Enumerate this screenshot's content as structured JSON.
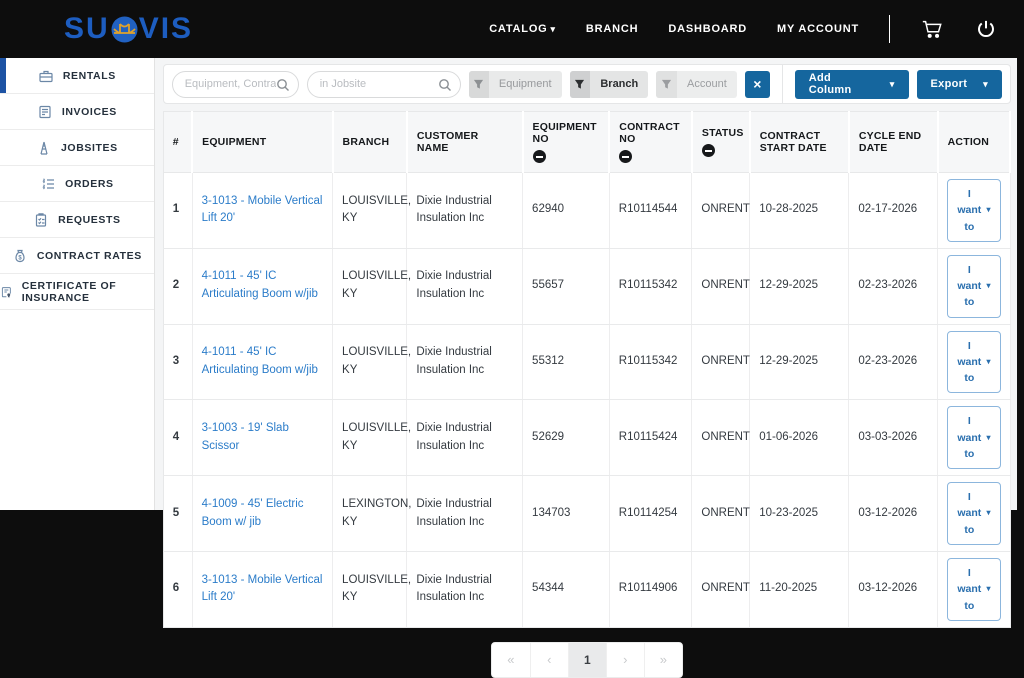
{
  "colors": {
    "brand_blue": "#1d5dc0",
    "button_blue": "#15669e",
    "link_blue": "#2b7cc9",
    "active_sidebar_bar": "#1d53a4",
    "bridge_gold": "#e0a22b"
  },
  "header": {
    "logo_pre": "SU",
    "logo_post": "VIS",
    "nav": [
      {
        "label": "CATALOG",
        "caret": "▾"
      },
      {
        "label": "BRANCH"
      },
      {
        "label": "DASHBOARD"
      },
      {
        "label": "MY ACCOUNT"
      }
    ]
  },
  "sidebar": {
    "items": [
      {
        "label": "RENTALS"
      },
      {
        "label": "INVOICES"
      },
      {
        "label": "JOBSITES"
      },
      {
        "label": "ORDERS"
      },
      {
        "label": "REQUESTS"
      },
      {
        "label": "CONTRACT RATES"
      },
      {
        "label": "CERTIFICATE OF INSURANCE"
      }
    ]
  },
  "filters": {
    "search_equipment_placeholder": "Equipment, Contract or PO",
    "search_jobsite_placeholder": "in Jobsite",
    "chips": [
      {
        "label": "Equipment"
      },
      {
        "label": "Branch"
      },
      {
        "label": "Account"
      }
    ],
    "clear_label": "×",
    "add_column_label": "Add Column",
    "export_label": "Export",
    "caret": "▾"
  },
  "table": {
    "columns": [
      "#",
      "EQUIPMENT",
      "BRANCH",
      "CUSTOMER NAME",
      "EQUIPMENT NO",
      "CONTRACT NO",
      "STATUS",
      "CONTRACT START DATE",
      "CYCLE END DATE",
      "ACTION"
    ],
    "action_label": "I want to",
    "action_caret": "▾",
    "rows": [
      {
        "num": "1",
        "equipment": "3-1013 - Mobile Vertical Lift 20'",
        "branch": "LOUISVILLE, KY",
        "customer": "Dixie Industrial Insulation Inc",
        "equipment_no": "62940",
        "contract_no": "R10114544",
        "status": "ONRENT",
        "start_date": "10-28-2025",
        "cycle_end_date": "02-17-2026"
      },
      {
        "num": "2",
        "equipment": "4-1011 - 45' IC Articulating Boom w/jib",
        "branch": "LOUISVILLE, KY",
        "customer": "Dixie Industrial Insulation Inc",
        "equipment_no": "55657",
        "contract_no": "R10115342",
        "status": "ONRENT",
        "start_date": "12-29-2025",
        "cycle_end_date": "02-23-2026"
      },
      {
        "num": "3",
        "equipment": "4-1011 - 45' IC Articulating Boom w/jib",
        "branch": "LOUISVILLE, KY",
        "customer": "Dixie Industrial Insulation Inc",
        "equipment_no": "55312",
        "contract_no": "R10115342",
        "status": "ONRENT",
        "start_date": "12-29-2025",
        "cycle_end_date": "02-23-2026"
      },
      {
        "num": "4",
        "equipment": "3-1003 - 19' Slab Scissor",
        "branch": "LOUISVILLE, KY",
        "customer": "Dixie Industrial Insulation Inc",
        "equipment_no": "52629",
        "contract_no": "R10115424",
        "status": "ONRENT",
        "start_date": "01-06-2026",
        "cycle_end_date": "03-03-2026"
      },
      {
        "num": "5",
        "equipment": "4-1009 - 45' Electric Boom w/ jib",
        "branch": "LEXINGTON, KY",
        "customer": "Dixie Industrial Insulation Inc",
        "equipment_no": "134703",
        "contract_no": "R10114254",
        "status": "ONRENT",
        "start_date": "10-23-2025",
        "cycle_end_date": "03-12-2026"
      },
      {
        "num": "6",
        "equipment": "3-1013 - Mobile Vertical Lift 20'",
        "branch": "LOUISVILLE, KY",
        "customer": "Dixie Industrial Insulation Inc",
        "equipment_no": "54344",
        "contract_no": "R10114906",
        "status": "ONRENT",
        "start_date": "11-20-2025",
        "cycle_end_date": "03-12-2026"
      }
    ]
  },
  "pagination": {
    "first": "«",
    "prev": "‹",
    "current": "1",
    "next": "›",
    "last": "»"
  }
}
